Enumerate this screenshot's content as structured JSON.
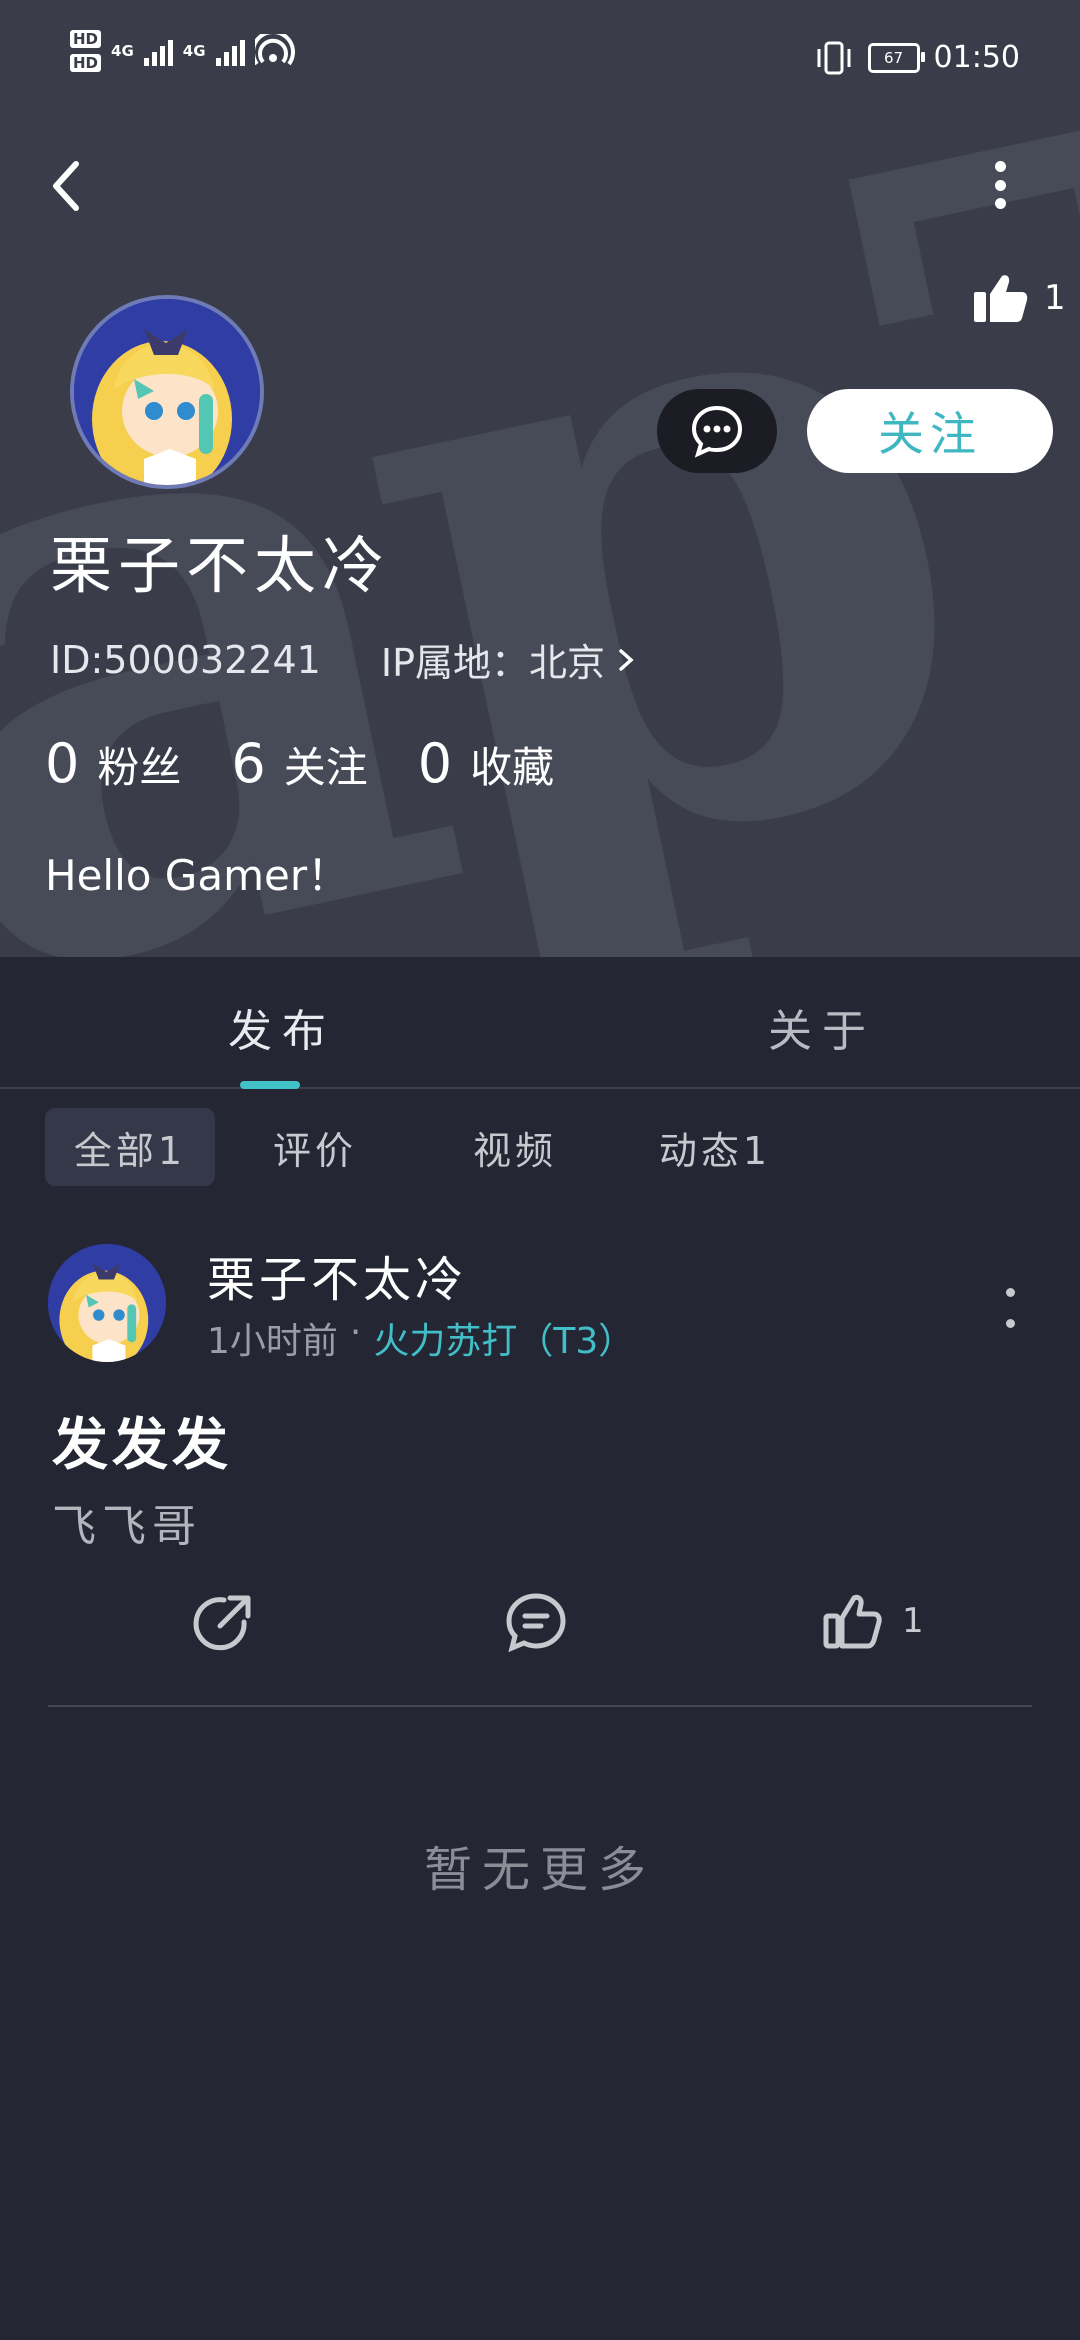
{
  "status_bar": {
    "hd1": "HD",
    "hd2": "HD",
    "net1": "4G",
    "net2": "4G",
    "battery": "67",
    "time": "01:50"
  },
  "header": {
    "like_count": "1"
  },
  "profile": {
    "username": "栗子不太冷",
    "id_text": "ID:500032241",
    "ip_text": "IP属地：北京",
    "follow_label": "关注",
    "stats": [
      {
        "value": "0",
        "label": "粉丝"
      },
      {
        "value": "6",
        "label": "关注"
      },
      {
        "value": "0",
        "label": "收藏"
      }
    ],
    "bio": "Hello Gamer！"
  },
  "tabs": {
    "main": [
      {
        "label": "发布"
      },
      {
        "label": "关于"
      }
    ],
    "sub": [
      {
        "label": "全部1"
      },
      {
        "label": "评价"
      },
      {
        "label": "视频"
      },
      {
        "label": "动态1"
      }
    ]
  },
  "post": {
    "author": "栗子不太冷",
    "time": "1小时前",
    "dot": "·",
    "game": "火力苏打（T3）",
    "title": "发发发",
    "body": "飞飞哥",
    "like_count": "1"
  },
  "footer": {
    "no_more": "暂无更多"
  },
  "colors": {
    "accent": "#43c1c9",
    "hero_bg": "#3a3c4a",
    "page_bg": "#242633"
  }
}
